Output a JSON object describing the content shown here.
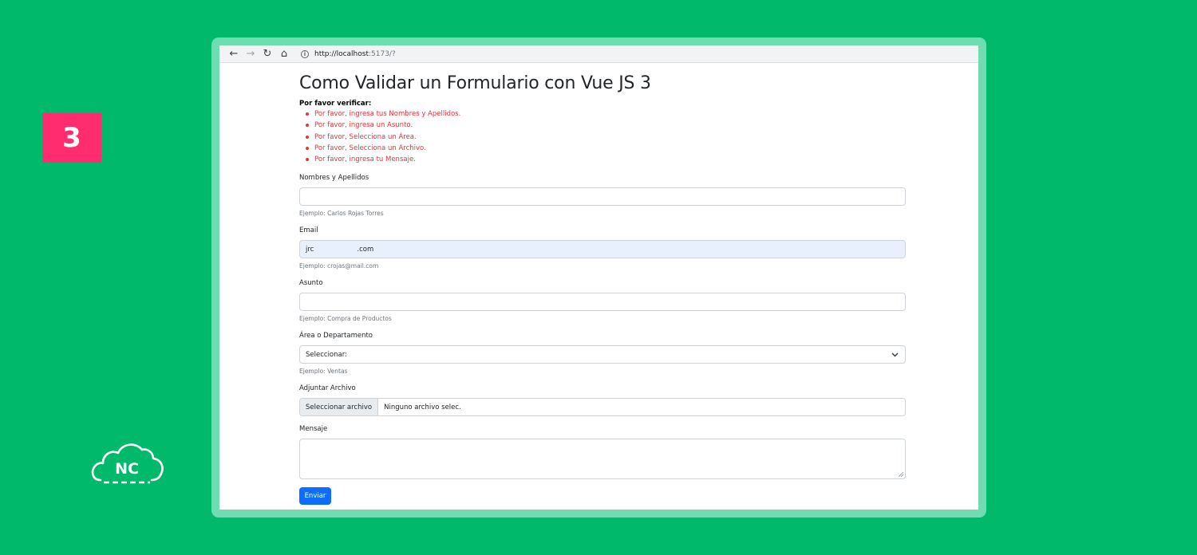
{
  "badge": {
    "number": "3"
  },
  "logo": {
    "text": "NC"
  },
  "browser": {
    "url_host": "http://localhost",
    "url_path": ":5173/?",
    "info_glyph": "i"
  },
  "page": {
    "title": "Como Validar un Formulario con Vue JS 3",
    "errors_heading": "Por favor verificar:",
    "errors": [
      "Por favor, ingresa tus Nombres y Apellidos.",
      "Por favor, ingresa un Asunto.",
      "Por favor, Selecciona un Área.",
      "Por favor, Selecciona un Archivo.",
      "Por favor, ingresa tu Mensaje."
    ]
  },
  "form": {
    "name": {
      "label": "Nombres y Apellidos",
      "value": "",
      "help": "Ejemplo: Carlos Rojas Torres"
    },
    "email": {
      "label": "Email",
      "value": "jrc                    .com",
      "help": "Ejemplo: crojas@mail.com"
    },
    "subject": {
      "label": "Asunto",
      "value": "",
      "help": "Ejemplo: Compra de Productos"
    },
    "area": {
      "label": "Área o Departamento",
      "selected": "Seleccionar:",
      "help": "Ejemplo: Ventas"
    },
    "file": {
      "label": "Adjuntar Archivo",
      "button": "Seleccionar archivo",
      "status": "Ninguno archivo selec."
    },
    "message": {
      "label": "Mensaje",
      "value": ""
    },
    "submit_label": "Enviar"
  },
  "colors": {
    "background": "#00b96b",
    "badge": "#ff2d6f",
    "error": "#e8323c",
    "primary_button": "#0d6efd",
    "autofill": "#e8f0fe"
  }
}
